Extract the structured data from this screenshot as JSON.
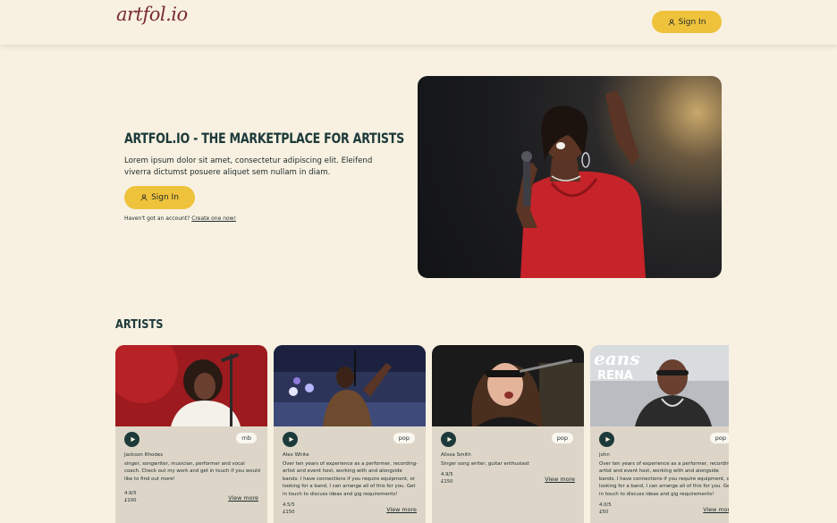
{
  "navbar": {
    "logo": "artfol.io",
    "signin_label": "Sign In"
  },
  "hero": {
    "title": "ARTFOL.IO - THE MARKETPLACE FOR ARTISTS",
    "text": "Lorem ipsum dolor sit amet, consectetur adipiscing elit. Eleifend viverra dictumst posuere aliquet sem nullam in diam.",
    "signin_label": "Sign In",
    "note": "Haven't got an account?",
    "create_link": "Create one now!"
  },
  "artists": {
    "title": "ARTISTS",
    "cards": [
      {
        "name": "Jackson Rhodes",
        "genre": "rnb",
        "description": "singer, songwriter, musician, performer and vocal coach. Check out my work and get in touch if you would like to find out more!",
        "rating": "4.9/5",
        "price": "£100",
        "view_more": "View more"
      },
      {
        "name": "Alex White",
        "genre": "pop",
        "description": "Over ten years of experience as a performer, recording-artist and event host, working with and alongside bands. I have connections if you require equipment, or looking for a band, I can arrange all of this for you. Get in touch to discuss ideas and gig requirements!",
        "rating": "4.5/5",
        "price": "£150",
        "view_more": "View more"
      },
      {
        "name": "Alissa Smith",
        "genre": "pop",
        "description": "Singer song writer, guitar enthusiast",
        "rating": "4.9/5",
        "price": "£150",
        "view_more": "View more"
      },
      {
        "name": "john",
        "genre": "pop",
        "description": "Over ten years of experience as a performer, recording-artist and event host, working with and alongside bands. I have connections if you require equipment, or looking for a band, I can arrange all of this for you. Get in touch to discuss ideas and gig requirements!",
        "rating": "4.0/5",
        "price": "£50",
        "view_more": "View more"
      }
    ]
  },
  "colors": {
    "background": "#f8f1e1",
    "accent": "#efc23c",
    "dark": "#1d3a3a",
    "card_body": "#ddd6c8"
  },
  "icons": {
    "user": "user-icon",
    "play": "play-icon"
  }
}
